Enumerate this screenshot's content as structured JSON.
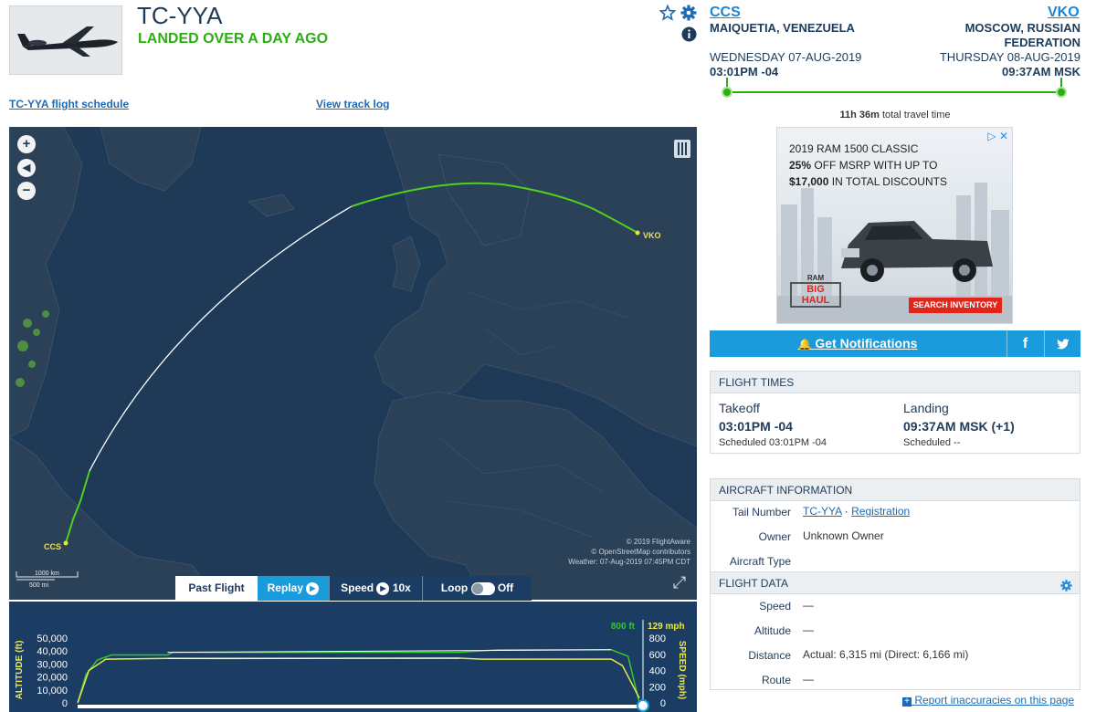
{
  "header": {
    "registration": "TC-YYA",
    "status": "LANDED OVER A DAY AGO",
    "schedule_link": "TC-YYA flight schedule",
    "track_link": "View track log"
  },
  "route": {
    "origin": {
      "code": "CCS",
      "city": "MAIQUETIA, VENEZUELA",
      "date": "WEDNESDAY 07-AUG-2019",
      "time": "03:01PM -04"
    },
    "destination": {
      "code": "VKO",
      "city_line1": "MOSCOW, RUSSIAN",
      "city_line2": "FEDERATION",
      "date": "THURSDAY 08-AUG-2019",
      "time": "09:37AM MSK"
    },
    "travel_time": "11h 36m",
    "travel_time_label": "total travel time"
  },
  "ad": {
    "line1": "2019 RAM 1500 CLASSIC",
    "line2_bold": "25%",
    "line2_rest": "OFF MSRP WITH UP TO",
    "line3_bold": "$17,000",
    "line3_rest": "IN TOTAL DISCOUNTS",
    "logo_top": "RAM",
    "logo_mid": "BIG",
    "logo_bottom": "HAUL",
    "cta": "SEARCH INVENTORY"
  },
  "notifications": {
    "label": "Get Notifications"
  },
  "flight_times": {
    "title": "FLIGHT TIMES",
    "takeoff_label": "Takeoff",
    "takeoff_time": "03:01PM -04",
    "takeoff_scheduled": "Scheduled 03:01PM -04",
    "landing_label": "Landing",
    "landing_time": "09:37AM MSK (+1)",
    "landing_scheduled": "Scheduled --"
  },
  "aircraft": {
    "title": "AIRCRAFT INFORMATION",
    "tail_label": "Tail Number",
    "tail_value": "TC-YYA",
    "tail_sep": "·",
    "registration_link": "Registration",
    "owner_label": "Owner",
    "owner_value": "Unknown Owner",
    "type_label": "Aircraft Type"
  },
  "flight_data": {
    "title": "FLIGHT DATA",
    "speed_label": "Speed",
    "speed_value": "—",
    "altitude_label": "Altitude",
    "altitude_value": "—",
    "distance_label": "Distance",
    "distance_value": "Actual: 6,315 mi (Direct: 6,166 mi)",
    "route_label": "Route",
    "route_value": "—"
  },
  "report_link": "Report inaccuracies on this page",
  "map": {
    "origin_label": "CCS",
    "destination_label": "VKO",
    "scale_top": "1000 km",
    "scale_bottom": "500 mi",
    "credit1": "© 2019 FlightAware",
    "credit2": "© OpenStreetMap contributors",
    "credit3": "Weather: 07-Aug-2019 07:45PM CDT",
    "tabs": {
      "past": "Past Flight",
      "replay": "Replay",
      "speed": "Speed",
      "speed_value": "10x",
      "loop": "Loop",
      "loop_state": "Off"
    }
  },
  "chart_data": {
    "type": "line",
    "altitude_axis_label": "ALTITUDE (ft)",
    "speed_axis_label": "SPEED (mph)",
    "altitude_ticks": [
      "50,000",
      "40,000",
      "30,000",
      "20,000",
      "10,000",
      "0"
    ],
    "speed_ticks": [
      "800",
      "600",
      "400",
      "200",
      "0"
    ],
    "current_altitude": "800 ft",
    "current_speed": "129 mph",
    "altitude_ylim": [
      0,
      50000
    ],
    "speed_ylim": [
      0,
      800
    ],
    "series": [
      {
        "name": "ALTITUDE (ft)",
        "color": "#32c832",
        "points": [
          [
            0,
            0
          ],
          [
            0.015,
            22000
          ],
          [
            0.035,
            33000
          ],
          [
            0.06,
            37000
          ],
          [
            0.16,
            37000
          ],
          [
            0.17,
            39000
          ],
          [
            0.68,
            39000
          ],
          [
            0.75,
            41000
          ],
          [
            0.95,
            41000
          ],
          [
            0.98,
            36000
          ],
          [
            1,
            0
          ]
        ]
      },
      {
        "name": "SPEED (mph)",
        "color": "#e8e84a",
        "points": [
          [
            0,
            0
          ],
          [
            0.02,
            400
          ],
          [
            0.05,
            540
          ],
          [
            0.16,
            550
          ],
          [
            0.25,
            548
          ],
          [
            0.68,
            552
          ],
          [
            0.72,
            540
          ],
          [
            0.95,
            540
          ],
          [
            0.97,
            460
          ],
          [
            1,
            60
          ]
        ]
      }
    ],
    "gap_segments": [
      [
        0.3,
        0.7
      ]
    ]
  },
  "colors": {
    "landed": "#2cae13",
    "link": "#1f6bb3",
    "route_track_flown": "#4fd11e",
    "route_track_gap": "#ffffff",
    "map_ocean": "#1f3a56",
    "map_land": "#2a4158"
  }
}
